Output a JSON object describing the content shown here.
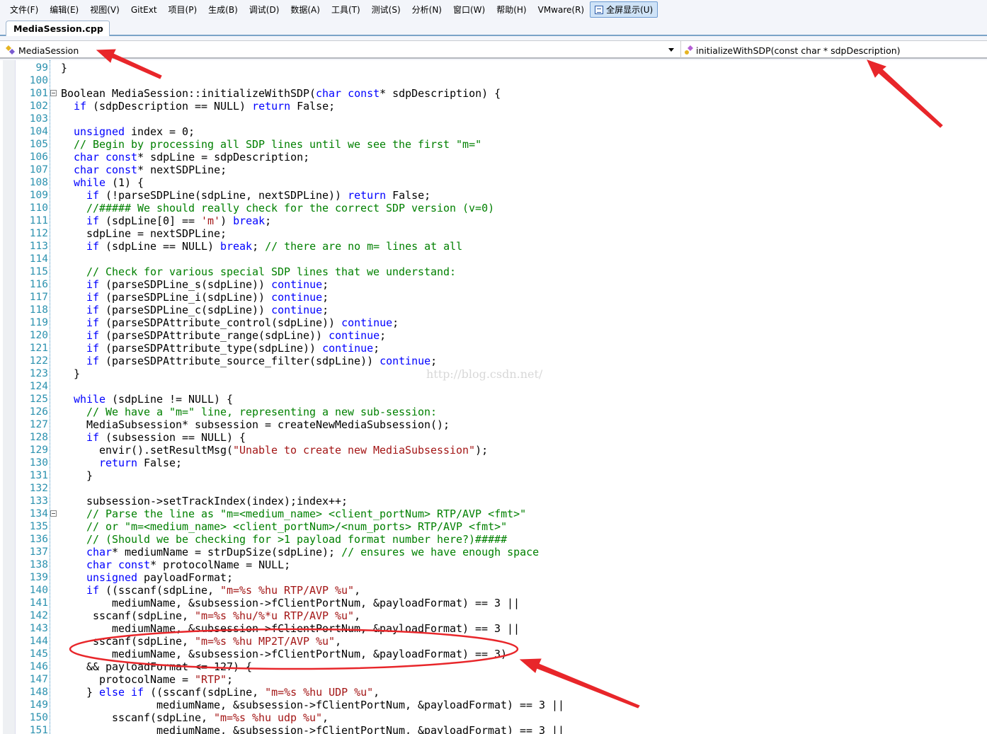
{
  "menu": [
    "文件(F)",
    "编辑(E)",
    "视图(V)",
    "GitExt",
    "项目(P)",
    "生成(B)",
    "调试(D)",
    "数据(A)",
    "工具(T)",
    "测试(S)",
    "分析(N)",
    "窗口(W)",
    "帮助(H)",
    "VMware(R)"
  ],
  "fullscreen_button": "全屏显示(U)",
  "tab": {
    "label": "MediaSession.cpp"
  },
  "nav": {
    "scope": "MediaSession",
    "member": "initializeWithSDP(const char * sdpDescription)"
  },
  "watermark": "http://blog.csdn.net/",
  "annotation_color": "#e8262a",
  "colors": {
    "keyword": "#0000ff",
    "comment": "#008000",
    "string": "#a31515",
    "line_number": "#2b91af"
  },
  "lines": [
    {
      "n": "99",
      "t": [
        [
          "p",
          "}"
        ]
      ]
    },
    {
      "n": "100",
      "t": []
    },
    {
      "n": "101",
      "fold": true,
      "t": [
        [
          "p",
          "Boolean MediaSession::initializeWithSDP("
        ],
        [
          "k",
          "char"
        ],
        [
          "p",
          " "
        ],
        [
          "k",
          "const"
        ],
        [
          "p",
          "* sdpDescription) {"
        ]
      ]
    },
    {
      "n": "102",
      "t": [
        [
          "p",
          "  "
        ],
        [
          "k",
          "if"
        ],
        [
          "p",
          " (sdpDescription == NULL) "
        ],
        [
          "k",
          "return"
        ],
        [
          "p",
          " False;"
        ]
      ]
    },
    {
      "n": "103",
      "t": []
    },
    {
      "n": "104",
      "t": [
        [
          "p",
          "  "
        ],
        [
          "k",
          "unsigned"
        ],
        [
          "p",
          " index = 0;"
        ]
      ]
    },
    {
      "n": "105",
      "t": [
        [
          "p",
          "  "
        ],
        [
          "c",
          "// Begin by processing all SDP lines until we see the first \"m=\""
        ]
      ]
    },
    {
      "n": "106",
      "t": [
        [
          "p",
          "  "
        ],
        [
          "k",
          "char"
        ],
        [
          "p",
          " "
        ],
        [
          "k",
          "const"
        ],
        [
          "p",
          "* sdpLine = sdpDescription;"
        ]
      ]
    },
    {
      "n": "107",
      "t": [
        [
          "p",
          "  "
        ],
        [
          "k",
          "char"
        ],
        [
          "p",
          " "
        ],
        [
          "k",
          "const"
        ],
        [
          "p",
          "* nextSDPLine;"
        ]
      ]
    },
    {
      "n": "108",
      "t": [
        [
          "p",
          "  "
        ],
        [
          "k",
          "while"
        ],
        [
          "p",
          " (1) {"
        ]
      ]
    },
    {
      "n": "109",
      "t": [
        [
          "p",
          "    "
        ],
        [
          "k",
          "if"
        ],
        [
          "p",
          " (!parseSDPLine(sdpLine, nextSDPLine)) "
        ],
        [
          "k",
          "return"
        ],
        [
          "p",
          " False;"
        ]
      ]
    },
    {
      "n": "110",
      "t": [
        [
          "p",
          "    "
        ],
        [
          "c",
          "//##### We should really check for the correct SDP version (v=0)"
        ]
      ]
    },
    {
      "n": "111",
      "t": [
        [
          "p",
          "    "
        ],
        [
          "k",
          "if"
        ],
        [
          "p",
          " (sdpLine[0] == "
        ],
        [
          "s",
          "'m'"
        ],
        [
          "p",
          ") "
        ],
        [
          "k",
          "break"
        ],
        [
          "p",
          ";"
        ]
      ]
    },
    {
      "n": "112",
      "t": [
        [
          "p",
          "    sdpLine = nextSDPLine;"
        ]
      ]
    },
    {
      "n": "113",
      "t": [
        [
          "p",
          "    "
        ],
        [
          "k",
          "if"
        ],
        [
          "p",
          " (sdpLine == NULL) "
        ],
        [
          "k",
          "break"
        ],
        [
          "p",
          "; "
        ],
        [
          "c",
          "// there are no m= lines at all"
        ]
      ]
    },
    {
      "n": "114",
      "t": []
    },
    {
      "n": "115",
      "t": [
        [
          "p",
          "    "
        ],
        [
          "c",
          "// Check for various special SDP lines that we understand:"
        ]
      ]
    },
    {
      "n": "116",
      "t": [
        [
          "p",
          "    "
        ],
        [
          "k",
          "if"
        ],
        [
          "p",
          " (parseSDPLine_s(sdpLine)) "
        ],
        [
          "k",
          "continue"
        ],
        [
          "p",
          ";"
        ]
      ]
    },
    {
      "n": "117",
      "t": [
        [
          "p",
          "    "
        ],
        [
          "k",
          "if"
        ],
        [
          "p",
          " (parseSDPLine_i(sdpLine)) "
        ],
        [
          "k",
          "continue"
        ],
        [
          "p",
          ";"
        ]
      ]
    },
    {
      "n": "118",
      "t": [
        [
          "p",
          "    "
        ],
        [
          "k",
          "if"
        ],
        [
          "p",
          " (parseSDPLine_c(sdpLine)) "
        ],
        [
          "k",
          "continue"
        ],
        [
          "p",
          ";"
        ]
      ]
    },
    {
      "n": "119",
      "t": [
        [
          "p",
          "    "
        ],
        [
          "k",
          "if"
        ],
        [
          "p",
          " (parseSDPAttribute_control(sdpLine)) "
        ],
        [
          "k",
          "continue"
        ],
        [
          "p",
          ";"
        ]
      ]
    },
    {
      "n": "120",
      "t": [
        [
          "p",
          "    "
        ],
        [
          "k",
          "if"
        ],
        [
          "p",
          " (parseSDPAttribute_range(sdpLine)) "
        ],
        [
          "k",
          "continue"
        ],
        [
          "p",
          ";"
        ]
      ]
    },
    {
      "n": "121",
      "t": [
        [
          "p",
          "    "
        ],
        [
          "k",
          "if"
        ],
        [
          "p",
          " (parseSDPAttribute_type(sdpLine)) "
        ],
        [
          "k",
          "continue"
        ],
        [
          "p",
          ";"
        ]
      ]
    },
    {
      "n": "122",
      "t": [
        [
          "p",
          "    "
        ],
        [
          "k",
          "if"
        ],
        [
          "p",
          " (parseSDPAttribute_source_filter(sdpLine)) "
        ],
        [
          "k",
          "continue"
        ],
        [
          "p",
          ";"
        ]
      ]
    },
    {
      "n": "123",
      "t": [
        [
          "p",
          "  }"
        ]
      ]
    },
    {
      "n": "124",
      "t": []
    },
    {
      "n": "125",
      "t": [
        [
          "p",
          "  "
        ],
        [
          "k",
          "while"
        ],
        [
          "p",
          " (sdpLine != NULL) {"
        ]
      ]
    },
    {
      "n": "126",
      "t": [
        [
          "p",
          "    "
        ],
        [
          "c",
          "// We have a \"m=\" line, representing a new sub-session:"
        ]
      ]
    },
    {
      "n": "127",
      "t": [
        [
          "p",
          "    MediaSubsession* subsession = createNewMediaSubsession();"
        ]
      ]
    },
    {
      "n": "128",
      "t": [
        [
          "p",
          "    "
        ],
        [
          "k",
          "if"
        ],
        [
          "p",
          " (subsession == NULL) {"
        ]
      ]
    },
    {
      "n": "129",
      "t": [
        [
          "p",
          "      envir().setResultMsg("
        ],
        [
          "s",
          "\"Unable to create new MediaSubsession\""
        ],
        [
          "p",
          ");"
        ]
      ]
    },
    {
      "n": "130",
      "t": [
        [
          "p",
          "      "
        ],
        [
          "k",
          "return"
        ],
        [
          "p",
          " False;"
        ]
      ]
    },
    {
      "n": "131",
      "t": [
        [
          "p",
          "    }"
        ]
      ]
    },
    {
      "n": "132",
      "t": []
    },
    {
      "n": "133",
      "t": [
        [
          "p",
          "    subsession->setTrackIndex(index);index++;"
        ]
      ]
    },
    {
      "n": "134",
      "fold": true,
      "t": [
        [
          "p",
          "    "
        ],
        [
          "c",
          "// Parse the line as \"m=<medium_name> <client_portNum> RTP/AVP <fmt>\""
        ]
      ]
    },
    {
      "n": "135",
      "t": [
        [
          "p",
          "    "
        ],
        [
          "c",
          "// or \"m=<medium_name> <client_portNum>/<num_ports> RTP/AVP <fmt>\""
        ]
      ]
    },
    {
      "n": "136",
      "t": [
        [
          "p",
          "    "
        ],
        [
          "c",
          "// (Should we be checking for >1 payload format number here?)#####"
        ]
      ]
    },
    {
      "n": "137",
      "t": [
        [
          "p",
          "    "
        ],
        [
          "k",
          "char"
        ],
        [
          "p",
          "* mediumName = strDupSize(sdpLine); "
        ],
        [
          "c",
          "// ensures we have enough space"
        ]
      ]
    },
    {
      "n": "138",
      "t": [
        [
          "p",
          "    "
        ],
        [
          "k",
          "char"
        ],
        [
          "p",
          " "
        ],
        [
          "k",
          "const"
        ],
        [
          "p",
          "* protocolName = NULL;"
        ]
      ]
    },
    {
      "n": "139",
      "t": [
        [
          "p",
          "    "
        ],
        [
          "k",
          "unsigned"
        ],
        [
          "p",
          " payloadFormat;"
        ]
      ]
    },
    {
      "n": "140",
      "t": [
        [
          "p",
          "    "
        ],
        [
          "k",
          "if"
        ],
        [
          "p",
          " ((sscanf(sdpLine, "
        ],
        [
          "s",
          "\"m=%s %hu RTP/AVP %u\""
        ],
        [
          "p",
          ","
        ]
      ]
    },
    {
      "n": "141",
      "t": [
        [
          "p",
          "        mediumName, &subsession->fClientPortNum, &payloadFormat) == 3 ||"
        ]
      ]
    },
    {
      "n": "142",
      "t": [
        [
          "p",
          "     sscanf(sdpLine, "
        ],
        [
          "s",
          "\"m=%s %hu/%*u RTP/AVP %u\""
        ],
        [
          "p",
          ","
        ]
      ]
    },
    {
      "n": "143",
      "t": [
        [
          "p",
          "        mediumName, &subsession->fClientPortNum, &payloadFormat) == 3 ||"
        ]
      ]
    },
    {
      "n": "144",
      "t": [
        [
          "p",
          "     sscanf(sdpLine, "
        ],
        [
          "s",
          "\"m=%s %hu MP2T/AVP %u\""
        ],
        [
          "p",
          ","
        ]
      ]
    },
    {
      "n": "145",
      "t": [
        [
          "p",
          "        mediumName, &subsession->fClientPortNum, &payloadFormat) == 3)"
        ]
      ]
    },
    {
      "n": "146",
      "t": [
        [
          "p",
          "    && payloadFormat <= 127) {"
        ]
      ]
    },
    {
      "n": "147",
      "t": [
        [
          "p",
          "      protocolName = "
        ],
        [
          "s",
          "\"RTP\""
        ],
        [
          "p",
          ";"
        ]
      ]
    },
    {
      "n": "148",
      "t": [
        [
          "p",
          "    } "
        ],
        [
          "k",
          "else"
        ],
        [
          "p",
          " "
        ],
        [
          "k",
          "if"
        ],
        [
          "p",
          " ((sscanf(sdpLine, "
        ],
        [
          "s",
          "\"m=%s %hu UDP %u\""
        ],
        [
          "p",
          ","
        ]
      ]
    },
    {
      "n": "149",
      "t": [
        [
          "p",
          "               mediumName, &subsession->fClientPortNum, &payloadFormat) == 3 ||"
        ]
      ]
    },
    {
      "n": "150",
      "t": [
        [
          "p",
          "        sscanf(sdpLine, "
        ],
        [
          "s",
          "\"m=%s %hu udp %u\""
        ],
        [
          "p",
          ","
        ]
      ]
    },
    {
      "n": "151",
      "t": [
        [
          "p",
          "               mediumName, &subsession->fClientPortNum, &payloadFormat) == 3 ||"
        ]
      ]
    }
  ]
}
